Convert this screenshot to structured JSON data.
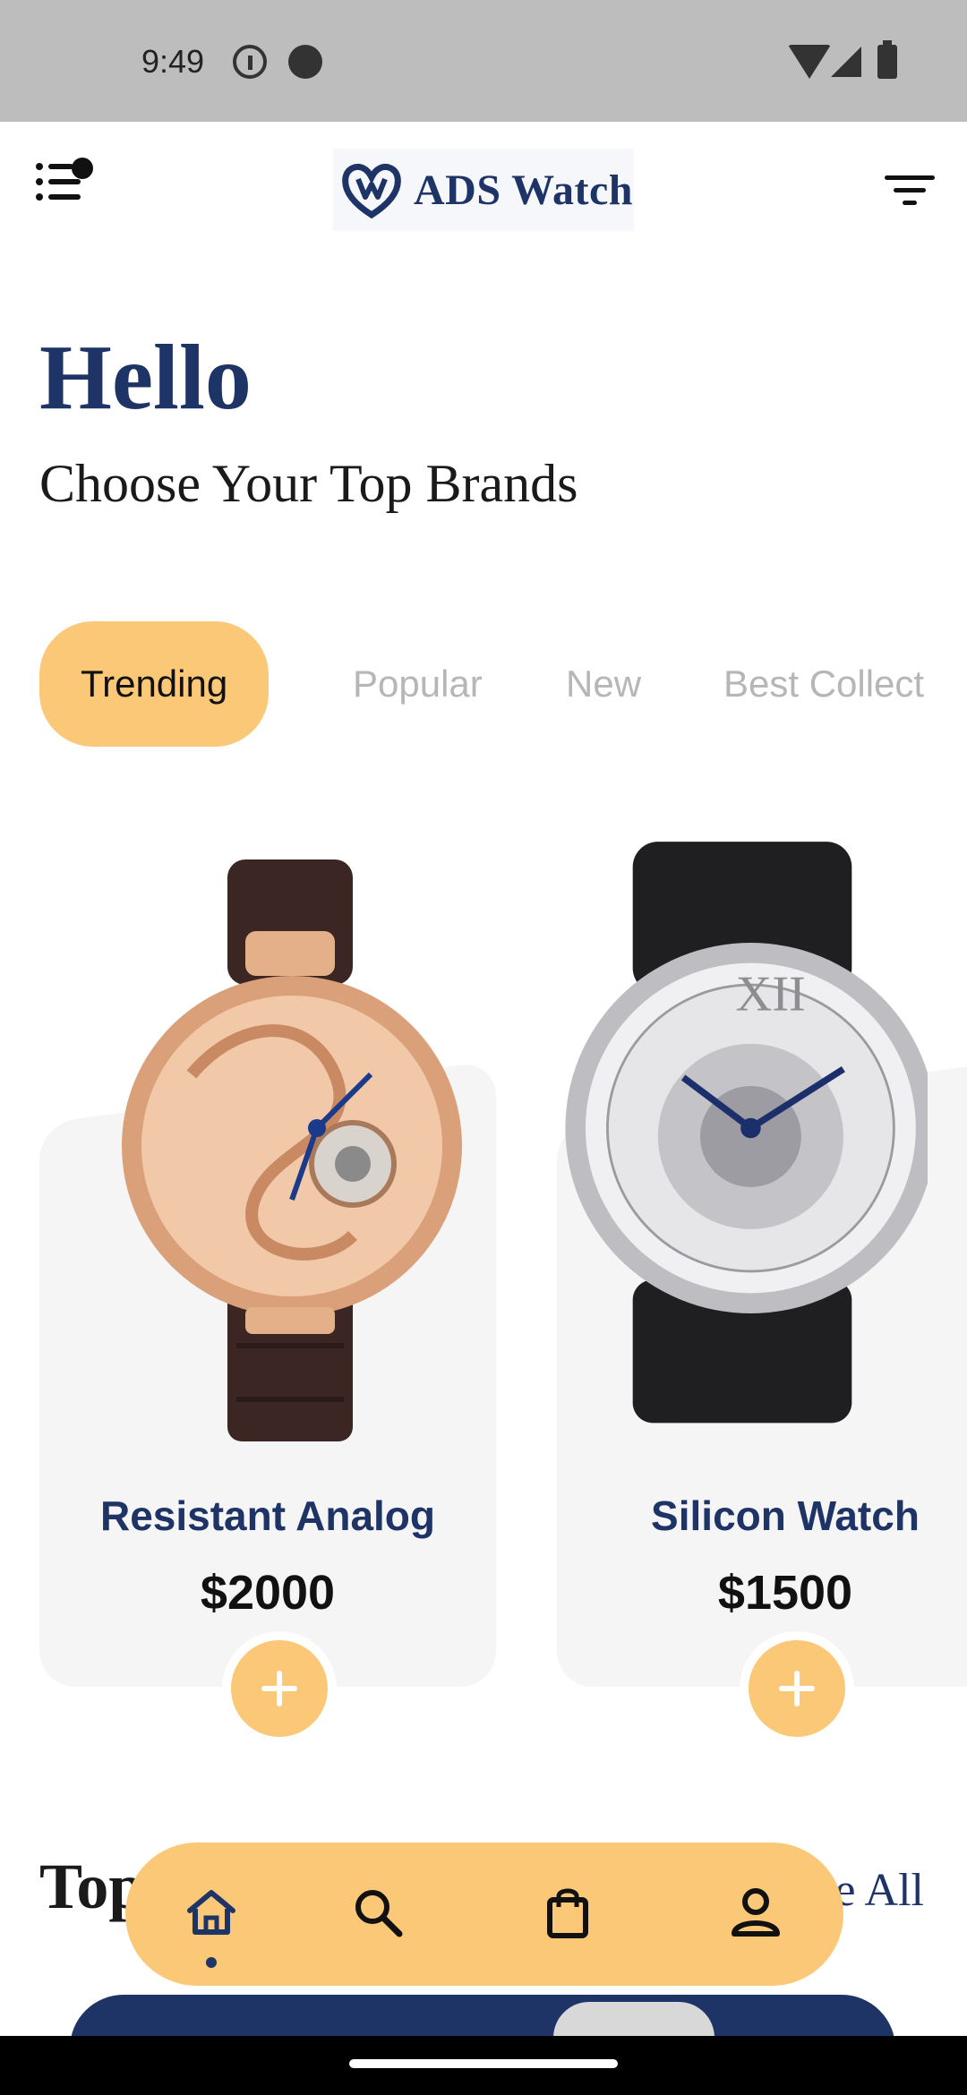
{
  "status_bar": {
    "time": "9:49",
    "icons": [
      "info-icon",
      "cat-icon",
      "wifi-icon",
      "signal-icon",
      "battery-icon"
    ]
  },
  "header": {
    "brand": "ADS Watch",
    "menu_icon": "menu-icon",
    "filter_icon": "filter-icon"
  },
  "greeting": {
    "title": "Hello",
    "subtitle": "Choose Your Top Brands"
  },
  "tabs": [
    {
      "label": "Trending",
      "active": true
    },
    {
      "label": "Popular",
      "active": false
    },
    {
      "label": "New",
      "active": false
    },
    {
      "label": "Best Collect",
      "active": false
    }
  ],
  "products": [
    {
      "name": "Resistant Analog",
      "price": "$2000"
    },
    {
      "name": "Silicon Watch",
      "price": "$1500"
    }
  ],
  "section": {
    "title": "Top",
    "see_all": "e All"
  },
  "bottom_nav": [
    {
      "icon": "home-icon",
      "active": true
    },
    {
      "icon": "search-icon",
      "active": false
    },
    {
      "icon": "shopping-bag-icon",
      "active": false
    },
    {
      "icon": "profile-icon",
      "active": false
    }
  ],
  "colors": {
    "accent": "#fbc877",
    "brand_navy": "#1e3466",
    "card_bg": "#f5f5f6"
  }
}
